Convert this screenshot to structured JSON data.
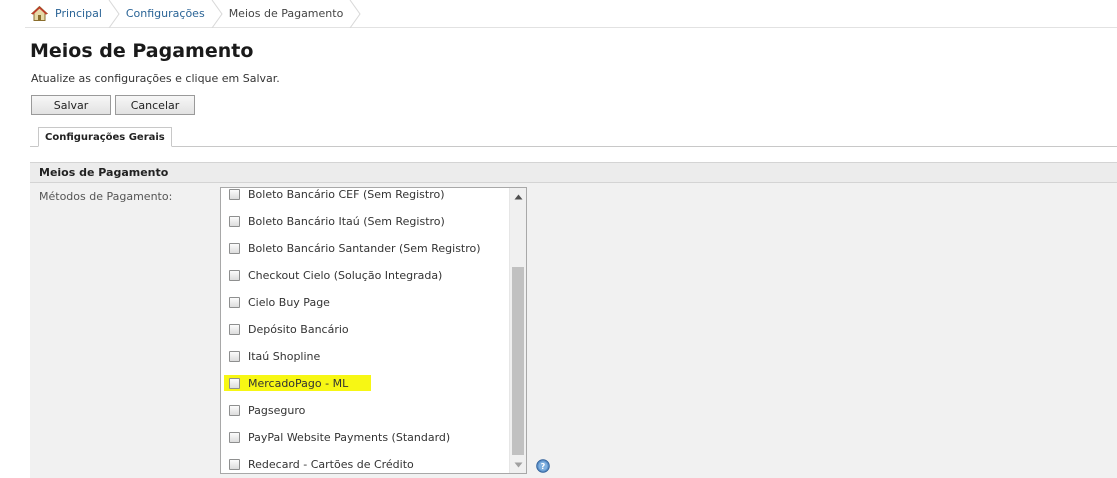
{
  "breadcrumb": {
    "items": [
      {
        "label": "Principal"
      },
      {
        "label": "Configurações"
      },
      {
        "label": "Meios de Pagamento"
      }
    ]
  },
  "page": {
    "title": "Meios de Pagamento",
    "subtitle": "Atualize as configurações e clique em Salvar."
  },
  "toolbar": {
    "save_label": "Salvar",
    "cancel_label": "Cancelar"
  },
  "tabs": [
    {
      "label": "Configurações Gerais",
      "active": true
    }
  ],
  "section": {
    "title": "Meios de Pagamento",
    "field_label": "Métodos de Pagamento:"
  },
  "payment_methods": [
    {
      "label": "Boleto Bancário CEF (Sem Registro)",
      "checked": false
    },
    {
      "label": "Boleto Bancário Itaú (Sem Registro)",
      "checked": false
    },
    {
      "label": "Boleto Bancário Santander (Sem Registro)",
      "checked": false
    },
    {
      "label": "Checkout Cielo (Solução Integrada)",
      "checked": false
    },
    {
      "label": "Cielo Buy Page",
      "checked": false
    },
    {
      "label": "Depósito Bancário",
      "checked": false
    },
    {
      "label": "Itaú Shopline",
      "checked": false
    },
    {
      "label": "MercadoPago - ML",
      "checked": false,
      "highlighted": true
    },
    {
      "label": "Pagseguro",
      "checked": false
    },
    {
      "label": "PayPal Website Payments (Standard)",
      "checked": false
    },
    {
      "label": "Redecard - Cartões de Crédito",
      "checked": false
    }
  ],
  "colors": {
    "link": "#2a6496",
    "highlight": "#f7f714",
    "panel": "#f1f1f1"
  },
  "icons": {
    "home": "home-icon",
    "help": "help-icon",
    "scroll_up": "chevron-up-icon",
    "scroll_down": "chevron-down-icon"
  }
}
